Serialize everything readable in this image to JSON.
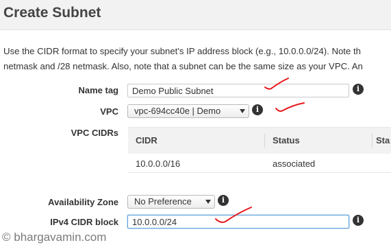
{
  "header": {
    "title": "Create Subnet"
  },
  "description": {
    "line1": "Use the CIDR format to specify your subnet's IP address block (e.g., 10.0.0.0/24). Note th",
    "line2": "netmask and /28 netmask. Also, note that a subnet can be the same size as your VPC. An"
  },
  "form": {
    "name_tag": {
      "label": "Name tag",
      "value": "Demo Public Subnet"
    },
    "vpc": {
      "label": "VPC",
      "selected": "vpc-694cc40e | Demo"
    },
    "vpc_cidrs": {
      "label": "VPC CIDRs",
      "columns": [
        "CIDR",
        "Status",
        "Sta"
      ],
      "rows": [
        {
          "cidr": "10.0.0.0/16",
          "status": "associated"
        }
      ]
    },
    "availability_zone": {
      "label": "Availability Zone",
      "selected": "No Preference"
    },
    "ipv4_cidr_block": {
      "label": "IPv4 CIDR block",
      "value": "10.0.0.0/24"
    }
  },
  "icons": {
    "info": "info-icon",
    "info_glyph": "i",
    "dropdown": "chevron-down-icon"
  },
  "annotation_color": "#e8171b",
  "watermark": "© bhargavamin.com"
}
